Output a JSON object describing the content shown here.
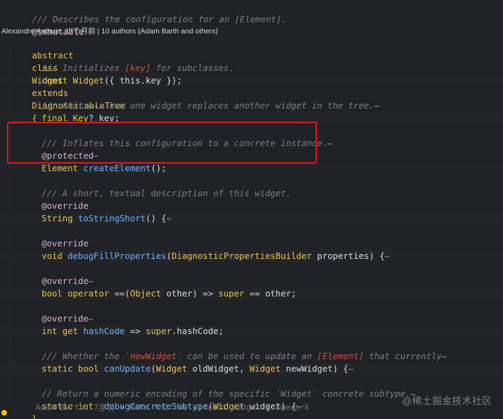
{
  "editor": {
    "header_comment": "/// Describes the configuration for an [Element].",
    "header_comment_tag": "[Element]",
    "annotation_immutable": "@immutable",
    "blame_info": "Alexandre Ardhuin, 17个月前 | 10 authors (Adam Barth and others)",
    "class_decl": {
      "kw1": "abstract",
      "kw2": "class",
      "name": "Widget",
      "kw3": "extends",
      "parent": "DiagnosticableTree",
      "brace": "{"
    },
    "lines": {
      "l1_comment": "/// Initializes ",
      "l1_tag": "[key]",
      "l1_rest": " for subclasses.",
      "l2_const": "const",
      "l2_widget": "Widget",
      "l2_rest": "({ this.key });",
      "l3_comment": "/// Controls how one widget replaces another widget in the tree.",
      "l4_final": "final",
      "l4_type": "Key",
      "l4_rest": "? key;",
      "l5_comment": "/// Inflates this configuration to a concrete instance.",
      "l6_annot": "@protected",
      "l7_type": "Element",
      "l7_func": "createElement",
      "l7_rest": "();",
      "l8_comment": "/// A short, textual description of this widget.",
      "l9_annot": "@override",
      "l10_type": "String",
      "l10_func": "toStringShort",
      "l10_rest": "() {",
      "l11_annot": "@override",
      "l12_void": "void",
      "l12_func": "debugFillProperties",
      "l12_paren": "(",
      "l12_type": "DiagnosticPropertiesBuilder",
      "l12_rest": " properties) {",
      "l13_annot": "@override",
      "l14_bool": "bool",
      "l14_op": "operator",
      "l14_eq": " ==(",
      "l14_type": "Object",
      "l14_mid": " other) => ",
      "l14_super": "super",
      "l14_end": " == other;",
      "l15_annot": "@override",
      "l16_int": "int",
      "l16_get": " get ",
      "l16_func": "hashCode",
      "l16_arrow": " => ",
      "l16_super": "super",
      "l16_end": ".hashCode;",
      "l17_comment_a": "/// Whether the ",
      "l17_code": "`newWidget`",
      "l17_comment_b": " can be used to update an ",
      "l17_tag": "[Element]",
      "l17_comment_c": " that currently",
      "l18_static": "static",
      "l18_bool": " bool ",
      "l18_func": "canUpdate",
      "l18_paren": "(",
      "l18_type1": "Widget",
      "l18_mid": " oldWidget, ",
      "l18_type2": "Widget",
      "l18_end": " newWidget) {",
      "l19_comment": "// Return a numeric encoding of the specific `Widget` concrete subtype.",
      "l20_static": "static",
      "l20_int": " int ",
      "l20_func": "_debugConcreteSubtype",
      "l20_paren": "(",
      "l20_type": "Widget",
      "l20_end": " widget) {",
      "closing_brace": "}"
    },
    "fold_marker": "⋯",
    "inline_blame": "Adam Barth, 7年前 • Make fn3 the default widget framework"
  },
  "watermark": "@稀土掘金技术社区",
  "colors": {
    "background": "#1f2124",
    "highlight_box": "#d61f1f",
    "keyword": "#e7c547",
    "function": "#6fb3ff",
    "comment": "#7b7f87"
  }
}
